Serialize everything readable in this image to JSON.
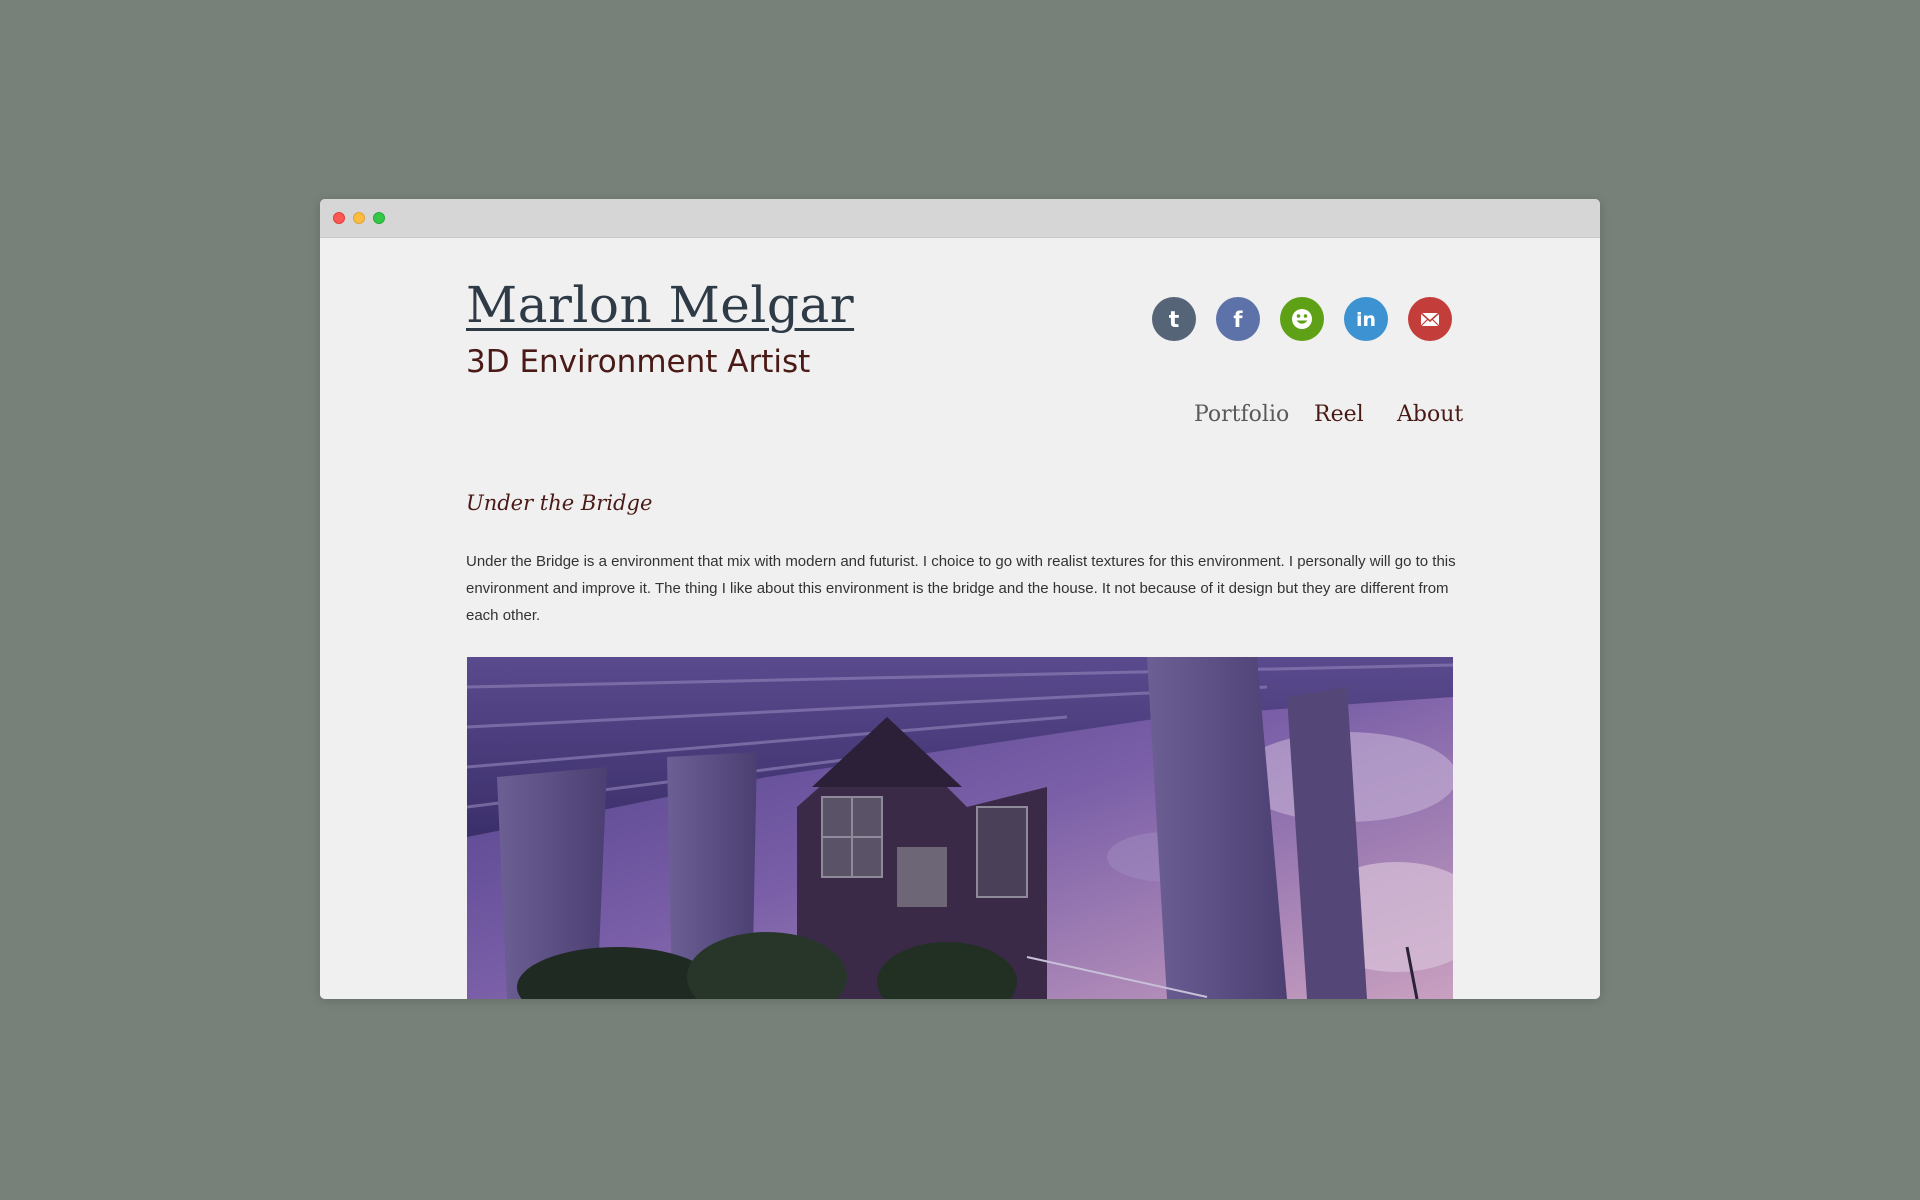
{
  "window": {
    "controls": [
      "close",
      "minimize",
      "maximize"
    ],
    "colors": {
      "close": "#fc5753",
      "minimize": "#fdbc40",
      "maximize": "#33c748"
    }
  },
  "header": {
    "title": "Marlon Melgar",
    "subtitle": "3D Environment Artist"
  },
  "social": [
    {
      "name": "tumblr",
      "icon": "tumblr-icon",
      "color": "#566478"
    },
    {
      "name": "facebook",
      "icon": "facebook-icon",
      "color": "#5e72aa"
    },
    {
      "name": "smiley",
      "icon": "smiley-icon",
      "color": "#5fa116"
    },
    {
      "name": "linkedin",
      "icon": "linkedin-icon",
      "color": "#3d93d2"
    },
    {
      "name": "email",
      "icon": "email-icon",
      "color": "#c33e3a"
    }
  ],
  "nav": {
    "items": [
      {
        "label": "Portfolio",
        "color": "#5a5a5a"
      },
      {
        "label": "Reel",
        "color": "#4a1a16"
      },
      {
        "label": "About",
        "color": "#4a1a16"
      }
    ]
  },
  "post": {
    "title": "Under the Bridge",
    "body": "Under the Bridge is a environment that mix with modern and futurist. I choice to go with realist textures for this environment. I personally will go to this environment and improve it. The thing I like about this environment is the bridge and the house. It not because of it design but they are different from each other."
  }
}
